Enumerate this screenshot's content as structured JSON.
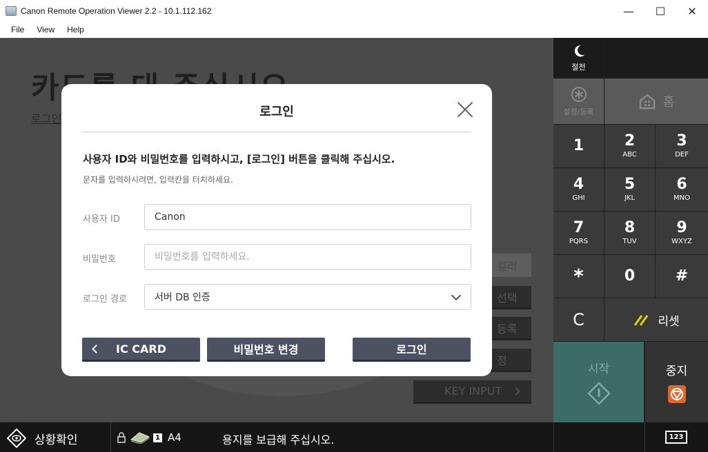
{
  "window": {
    "title": "Canon Remote Operation Viewer 2.2 - 10.1.112.162",
    "controls": {
      "minimize": "—",
      "maximize": "☐",
      "close": "✕"
    }
  },
  "menu": [
    "File",
    "View",
    "Help"
  ],
  "background": {
    "heading": "카드를 대 주십시오",
    "subheading": "로그인",
    "buttons": [
      "컬러",
      "선택",
      "등록",
      "정",
      "KEY INPUT"
    ]
  },
  "dialog": {
    "title": "로그인",
    "instruction": "사용자 ID와 비밀번호를 입력하시고, [로그인] 버튼을 클릭해 주십시오.",
    "hint": "문자를 입력하시려면, 입력칸을 터치하세요.",
    "fields": {
      "user_id_label": "사용자 ID",
      "user_id_value": "Canon",
      "password_label": "비밀번호",
      "password_placeholder": "비밀번호를 입력하세요.",
      "route_label": "로그인 경로",
      "route_value": "서버 DB 인증"
    },
    "buttons": {
      "ic_card": "IC CARD",
      "change_password": "비밀번호 변경",
      "login": "로그인"
    }
  },
  "panel": {
    "sleep_label": "절전",
    "settings_label": "설정/등록",
    "home_label": "홈",
    "keys": [
      {
        "num": "1",
        "sub": ""
      },
      {
        "num": "2",
        "sub": "ABC"
      },
      {
        "num": "3",
        "sub": "DEF"
      },
      {
        "num": "4",
        "sub": "GHI"
      },
      {
        "num": "5",
        "sub": "JKL"
      },
      {
        "num": "6",
        "sub": "MNO"
      },
      {
        "num": "7",
        "sub": "PQRS"
      },
      {
        "num": "8",
        "sub": "TUV"
      },
      {
        "num": "9",
        "sub": "WXYZ"
      },
      {
        "num": "*",
        "sub": ""
      },
      {
        "num": "0",
        "sub": ""
      },
      {
        "num": "#",
        "sub": ""
      }
    ],
    "clear_label": "C",
    "reset_label": "리셋",
    "start_label": "시작",
    "stop_label": "중지"
  },
  "status": {
    "monitor_label": "상황확인",
    "tray_number": "1",
    "paper_size": "A4",
    "message": "용지를 보급해 주십시오.",
    "counter_label": "123"
  }
}
